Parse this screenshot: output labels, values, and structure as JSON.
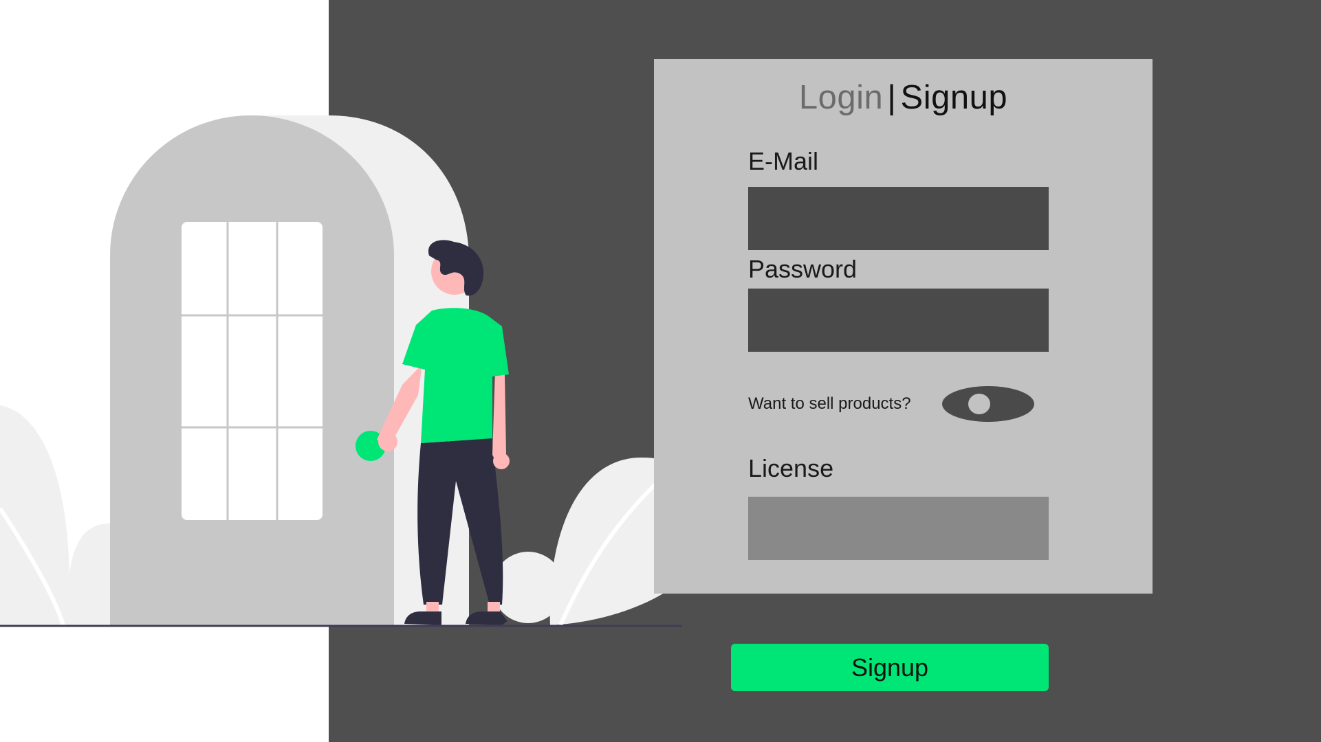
{
  "tabs": {
    "login_label": "Login",
    "separator": "|",
    "signup_label": "Signup",
    "active": "Signup"
  },
  "form": {
    "email_label": "E-Mail",
    "email_value": "",
    "password_label": "Password",
    "password_value": "",
    "seller_toggle_label": "Want to sell products?",
    "seller_toggle_on": false,
    "license_label": "License",
    "license_value": "",
    "submit_label": "Signup"
  },
  "colors": {
    "accent": "#00e676",
    "panel": "#4f4f4f",
    "card": "#c2c2c2",
    "input": "#4a4a4a",
    "input_disabled": "#898989"
  },
  "illustration": {
    "subject": "person-standing-at-door",
    "icons": [
      "door-icon",
      "plant-icon",
      "person-icon"
    ]
  }
}
